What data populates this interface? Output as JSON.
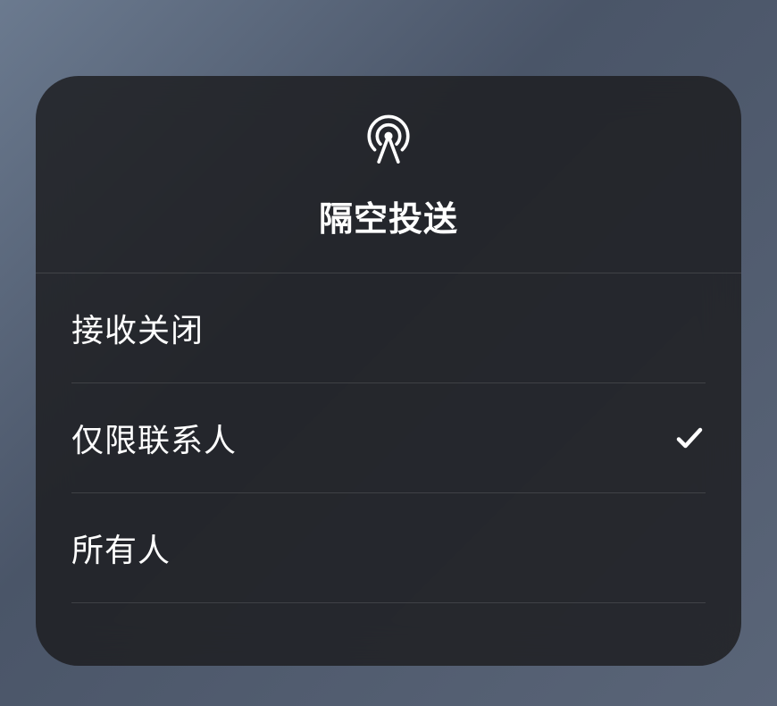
{
  "header": {
    "title": "隔空投送"
  },
  "options": [
    {
      "label": "接收关闭",
      "selected": false
    },
    {
      "label": "仅限联系人",
      "selected": true
    },
    {
      "label": "所有人",
      "selected": false
    }
  ]
}
